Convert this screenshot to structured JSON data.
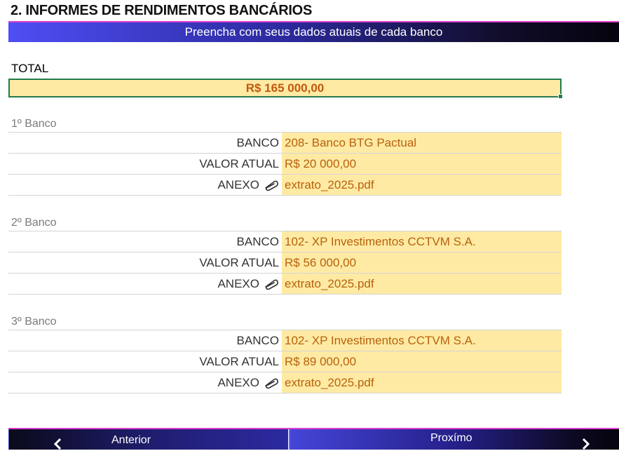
{
  "section": {
    "title": "2. INFORMES DE RENDIMENTOS BANCÁRIOS",
    "subtitle": "Preencha com seus dados atuais de cada banco"
  },
  "total": {
    "label": "TOTAL",
    "value": "R$ 165 000,00"
  },
  "labels": {
    "banco": "BANCO",
    "valor": "VALOR ATUAL",
    "anexo": "ANEXO"
  },
  "banks": [
    {
      "title": "1º Banco",
      "banco": "208- Banco BTG Pactual",
      "valor": "R$ 20 000,00",
      "anexo": "extrato_2025.pdf"
    },
    {
      "title": "2º Banco",
      "banco": "102- XP Investimentos CCTVM S.A.",
      "valor": "R$ 56 000,00",
      "anexo": "extrato_2025.pdf"
    },
    {
      "title": "3º Banco",
      "banco": "102- XP Investimentos CCTVM S.A.",
      "valor": "R$ 89 000,00",
      "anexo": "extrato_2025.pdf"
    }
  ],
  "nav": {
    "prev": "Anterior",
    "next": "Proxímo"
  },
  "icons": {
    "attachment": "paperclip-icon",
    "prev": "chevron-left-icon",
    "next": "chevron-right-icon"
  },
  "colors": {
    "input_fill": "#ffeaa4",
    "input_text": "#b8620c",
    "banner_start": "#4e4ef5",
    "banner_end": "#05030d",
    "accent_line": "#e03fd0",
    "selection_border": "#237a4a"
  }
}
